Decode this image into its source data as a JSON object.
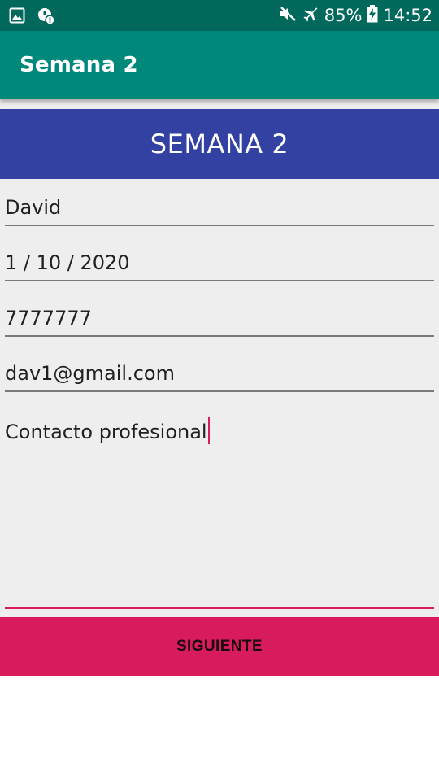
{
  "status_bar": {
    "battery": "85%",
    "time": "14:52",
    "icons": [
      "image-notification-icon",
      "security-notification-icon",
      "mute-icon",
      "airplane-mode-icon",
      "battery-charging-icon"
    ]
  },
  "app_bar": {
    "title": "Semana 2"
  },
  "banner": {
    "title": "SEMANA 2"
  },
  "form": {
    "name": "David",
    "date": "1 / 10 / 2020",
    "phone": "7777777",
    "email": "dav1@gmail.com",
    "description": "Contacto profesional"
  },
  "next_button": {
    "label": "SIGUIENTE"
  },
  "colors": {
    "status_bar": "#00695c",
    "app_bar": "#00897b",
    "banner": "#3341a2",
    "accent": "#d81b60",
    "background": "#eeeeee"
  }
}
